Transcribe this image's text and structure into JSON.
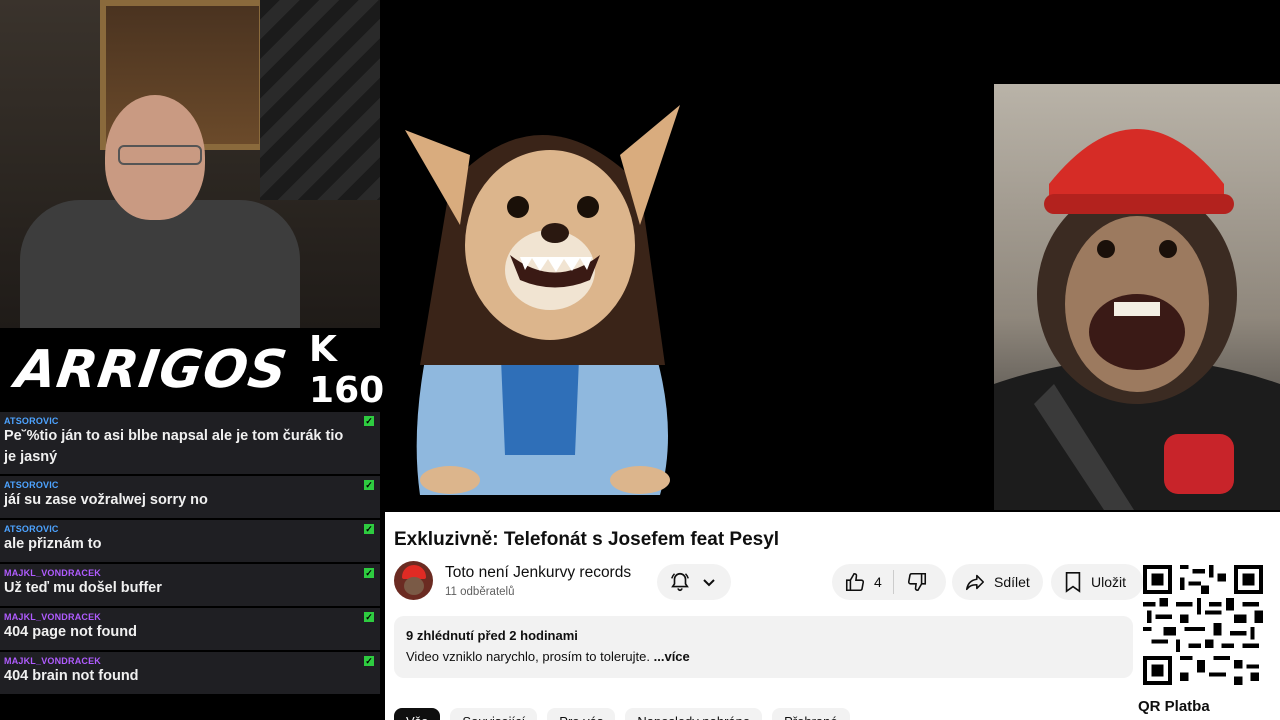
{
  "stream": {
    "logo_text": "ARRIGOS",
    "logo_sub": "K 160"
  },
  "chat": {
    "messages": [
      {
        "user": "ATSOROVIC",
        "text": "Pe˘%tio ján to asi blbe napsal ale je tom čurák tio je jasný",
        "user_color": "#4da3ff"
      },
      {
        "user": "ATSOROVIC",
        "text": "jáí su zase vožralwej sorry no",
        "user_color": "#4da3ff"
      },
      {
        "user": "ATSOROVIC",
        "text": "ale přiznám to",
        "user_color": "#4da3ff"
      },
      {
        "user": "MAJKL_VONDRACEK",
        "text": "Už teď mu došel buffer",
        "user_color": "#b05cff"
      },
      {
        "user": "MAJKL_VONDRACEK",
        "text": "404 page not found",
        "user_color": "#b05cff"
      },
      {
        "user": "MAJKL_VONDRACEK",
        "text": "404 brain not found",
        "user_color": "#b05cff"
      }
    ]
  },
  "video": {
    "title": "Exkluzivně: Telefonát s Josefem feat Pesyl",
    "channel_name": "Toto není Jenkurvy records",
    "subscribers": "11 odběratelů",
    "likes": "4",
    "share_label": "Sdílet",
    "save_label": "Uložit",
    "views_time": "9 zhlédnutí  před 2 hodinami",
    "description": "Video vzniklo narychlo, prosím to tolerujte.",
    "more_label": "...více",
    "chips": [
      "Vše",
      "Související",
      "Pro vás",
      "Naposledy nahráno",
      "Přehrané"
    ]
  },
  "qr": {
    "label": "QR Platba"
  },
  "colors": {
    "chat_bg": "#1f1f23",
    "flag_green": "#2ecc40",
    "yt_pill": "#f2f2f2"
  }
}
